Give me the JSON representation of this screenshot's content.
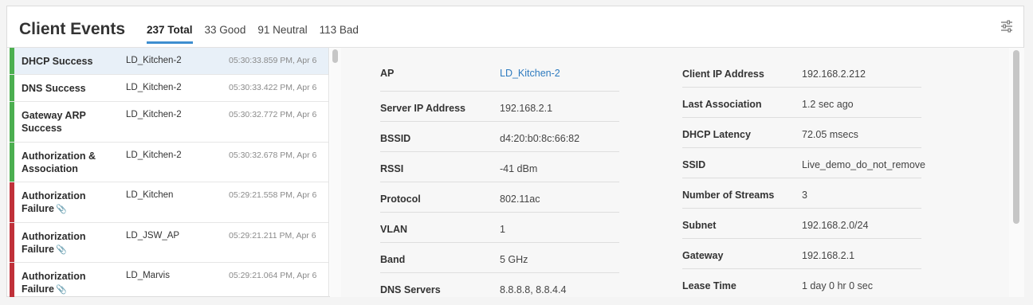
{
  "title": "Client Events",
  "tabs": [
    {
      "label": "237 Total",
      "active": true
    },
    {
      "label": "33 Good",
      "active": false
    },
    {
      "label": "91 Neutral",
      "active": false
    },
    {
      "label": "113 Bad",
      "active": false
    }
  ],
  "filter_icon": "sliders-icon",
  "colors": {
    "good": "#4caf50",
    "bad": "#c0313a",
    "accent": "#3e8ed0",
    "link": "#2e7bbf"
  },
  "events": [
    {
      "name": "DHCP Success",
      "ap": "LD_Kitchen-2",
      "time": "05:30:33.859 PM, Apr 6",
      "status": "good",
      "clip": false
    },
    {
      "name": "DNS Success",
      "ap": "LD_Kitchen-2",
      "time": "05:30:33.422 PM, Apr 6",
      "status": "good",
      "clip": false
    },
    {
      "name": "Gateway ARP Success",
      "ap": "LD_Kitchen-2",
      "time": "05:30:32.772 PM, Apr 6",
      "status": "good",
      "clip": false
    },
    {
      "name": "Authorization & Association",
      "ap": "LD_Kitchen-2",
      "time": "05:30:32.678 PM, Apr 6",
      "status": "good",
      "clip": false
    },
    {
      "name": "Authorization Failure",
      "ap": "LD_Kitchen",
      "time": "05:29:21.558 PM, Apr 6",
      "status": "bad",
      "clip": true
    },
    {
      "name": "Authorization Failure",
      "ap": "LD_JSW_AP",
      "time": "05:29:21.211 PM, Apr 6",
      "status": "bad",
      "clip": true
    },
    {
      "name": "Authorization Failure",
      "ap": "LD_Marvis",
      "time": "05:29:21.064 PM, Apr 6",
      "status": "bad",
      "clip": true
    }
  ],
  "details": {
    "left": [
      {
        "label": "AP",
        "value": "LD_Kitchen-2",
        "link": true
      },
      {
        "label": "Server IP Address",
        "value": "192.168.2.1"
      },
      {
        "label": "BSSID",
        "value": "d4:20:b0:8c:66:82"
      },
      {
        "label": "RSSI",
        "value": "-41 dBm"
      },
      {
        "label": "Protocol",
        "value": "802.11ac"
      },
      {
        "label": "VLAN",
        "value": "1"
      },
      {
        "label": "Band",
        "value": "5 GHz"
      },
      {
        "label": "DNS Servers",
        "value": "8.8.8.8, 8.8.4.4"
      }
    ],
    "right": [
      {
        "label": "Client IP Address",
        "value": "192.168.2.212"
      },
      {
        "label": "Last Association",
        "value": "1.2 sec ago"
      },
      {
        "label": "DHCP Latency",
        "value": "72.05 msecs"
      },
      {
        "label": "SSID",
        "value": "Live_demo_do_not_remove"
      },
      {
        "label": "Number of Streams",
        "value": "3"
      },
      {
        "label": "Subnet",
        "value": "192.168.2.0/24"
      },
      {
        "label": "Gateway",
        "value": "192.168.2.1"
      },
      {
        "label": "Lease Time",
        "value": "1 day 0 hr 0 sec"
      }
    ]
  }
}
